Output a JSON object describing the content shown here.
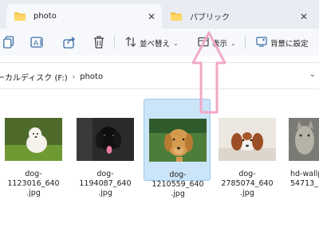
{
  "tabs": [
    {
      "title": "photo",
      "active": true
    },
    {
      "title": "パブリック",
      "active": false
    }
  ],
  "toolbar": {
    "sort_label": "並べ替え",
    "view_label": "表示",
    "background_label": "背景に設定"
  },
  "address": {
    "crumb_drive": "ーカルディスク (F:)",
    "crumb_folder": "photo"
  },
  "files": [
    {
      "name": "dog-1123016_640\n.jpg",
      "selected": false
    },
    {
      "name": "dog-1194087_640\n.jpg",
      "selected": false
    },
    {
      "name": "dog-1210559_640\n.jpg",
      "selected": true
    },
    {
      "name": "dog-2785074_640\n.jpg",
      "selected": false
    },
    {
      "name": "hd-wallp\n54713_1",
      "selected": false
    }
  ],
  "colors": {
    "accent": "#0067c0",
    "selection": "#cce4f7",
    "annotation_arrow": "#f1a9c6",
    "folder": "#f3c343"
  },
  "icons": [
    "folder-icon",
    "copy-icon",
    "rename-icon",
    "share-icon",
    "delete-icon",
    "sort-icon",
    "view-icon",
    "set-background-icon",
    "close-icon",
    "chevron-down-icon"
  ]
}
